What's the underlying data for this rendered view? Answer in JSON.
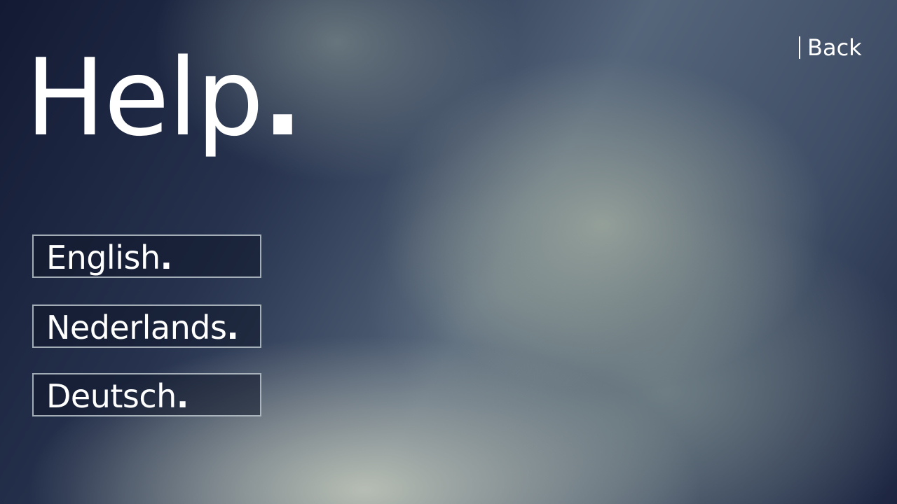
{
  "header": {
    "title": "Help",
    "title_dot": "."
  },
  "nav": {
    "back_label": "Back"
  },
  "languages": [
    {
      "label": "English",
      "dot": "."
    },
    {
      "label": "Nederlands",
      "dot": "."
    },
    {
      "label": "Deutsch",
      "dot": "."
    }
  ],
  "colors": {
    "text": "#ffffff",
    "button_border": "#c8d2d8",
    "background_dark": "#131a33",
    "background_light": "#c8cdbe"
  }
}
